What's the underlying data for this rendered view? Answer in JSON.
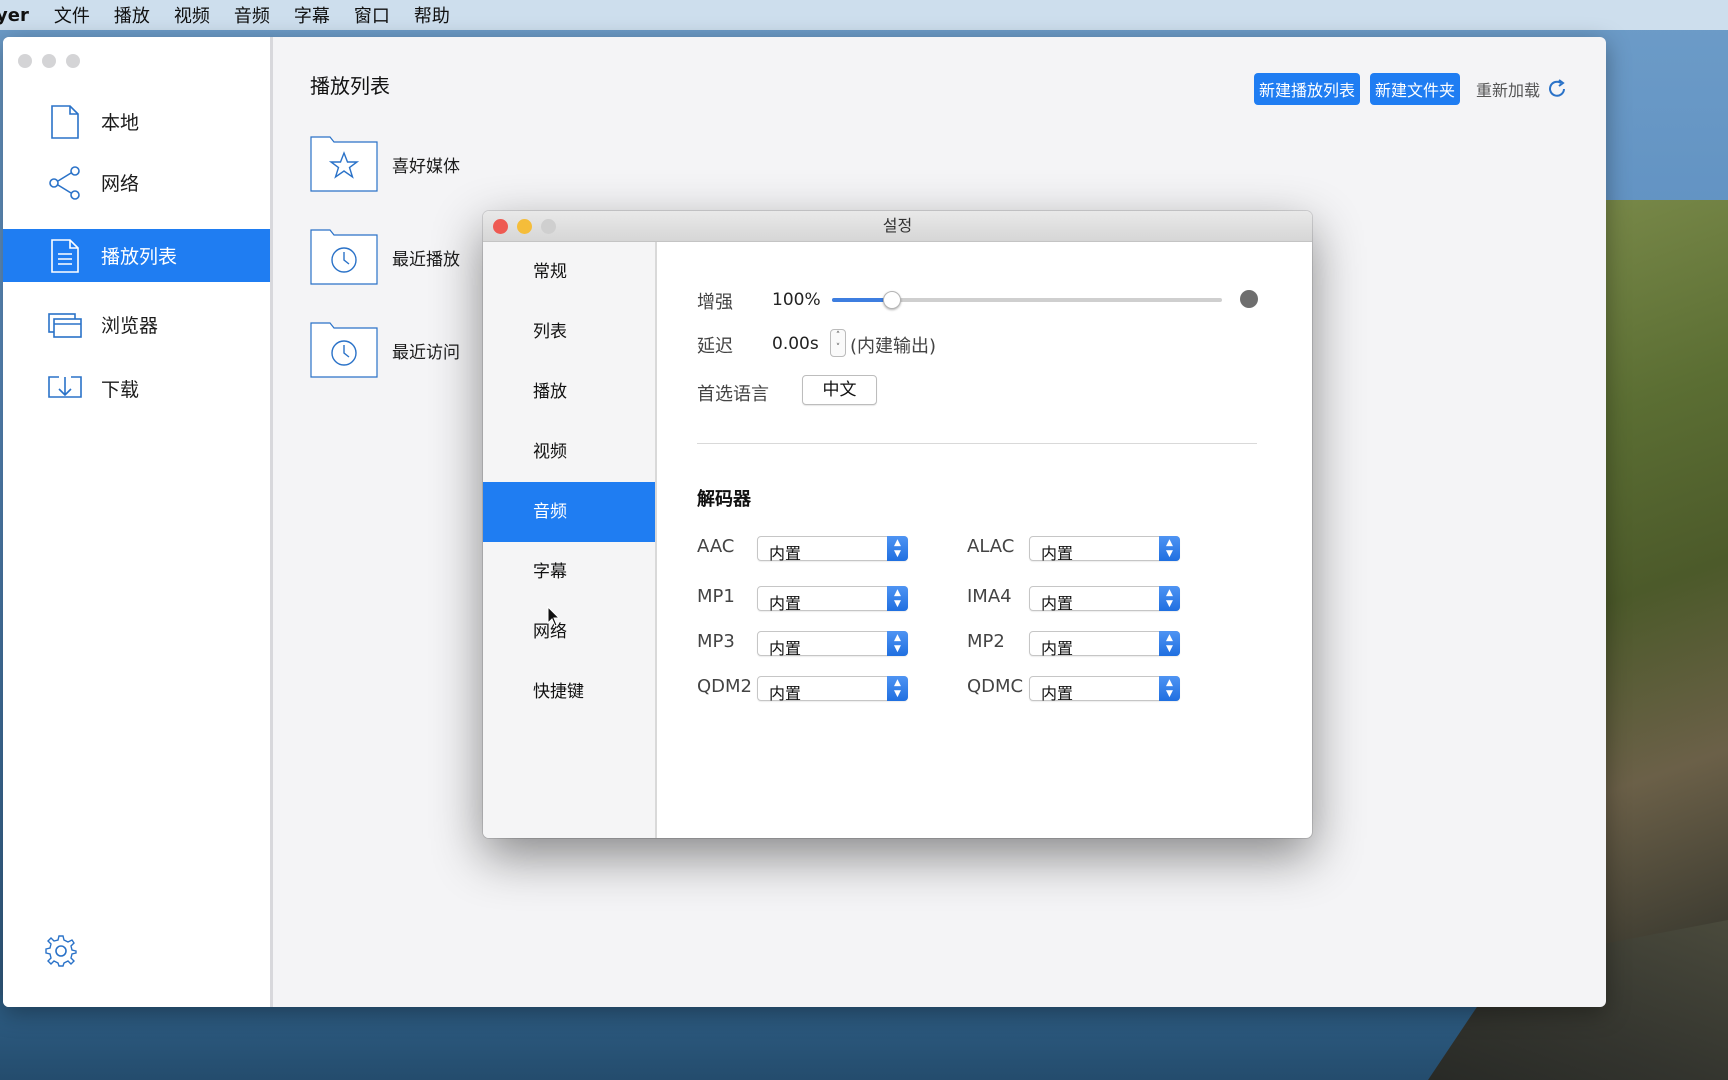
{
  "menubar": {
    "app_name": "yer",
    "items": [
      "文件",
      "播放",
      "视频",
      "音频",
      "字幕",
      "窗口",
      "帮助"
    ]
  },
  "sidebar": {
    "items": [
      {
        "label": "本地",
        "icon": "file-icon"
      },
      {
        "label": "网络",
        "icon": "share-icon"
      },
      {
        "label": "播放列表",
        "icon": "playlist-icon",
        "active": true
      },
      {
        "label": "浏览器",
        "icon": "browser-icon"
      },
      {
        "label": "下载",
        "icon": "download-icon"
      }
    ],
    "settings_icon": "gear-icon"
  },
  "content": {
    "title": "播放列表",
    "buttons": {
      "new_playlist": "新建播放列表",
      "new_folder": "新建文件夹",
      "reload": "重新加载"
    },
    "folders": [
      {
        "label": "喜好媒体",
        "icon": "star-folder-icon"
      },
      {
        "label": "最近播放",
        "icon": "clock-folder-icon"
      },
      {
        "label": "最近访问",
        "icon": "clock-folder-icon"
      }
    ]
  },
  "dialog": {
    "title": "설정",
    "tabs": [
      "常规",
      "列表",
      "播放",
      "视频",
      "音频",
      "字幕",
      "网络",
      "快捷键"
    ],
    "active_tab": "音频",
    "audio": {
      "boost_label": "增强",
      "boost_value": "100%",
      "boost_fraction": 0.15,
      "delay_label": "延迟",
      "delay_value": "0.00s",
      "delay_note": "(内建输出)",
      "language_label": "首选语言",
      "language_value": "中文",
      "decoder_title": "解码器",
      "decoders": [
        {
          "name": "AAC",
          "value": "内置"
        },
        {
          "name": "ALAC",
          "value": "内置"
        },
        {
          "name": "MP1",
          "value": "内置"
        },
        {
          "name": "IMA4",
          "value": "内置"
        },
        {
          "name": "MP3",
          "value": "内置"
        },
        {
          "name": "MP2",
          "value": "内置"
        },
        {
          "name": "QDM2",
          "value": "内置"
        },
        {
          "name": "QDMC",
          "value": "内置"
        }
      ]
    }
  },
  "colors": {
    "accent": "#1f7df2",
    "close": "#ee5a52",
    "minimize": "#f5bd3a"
  }
}
